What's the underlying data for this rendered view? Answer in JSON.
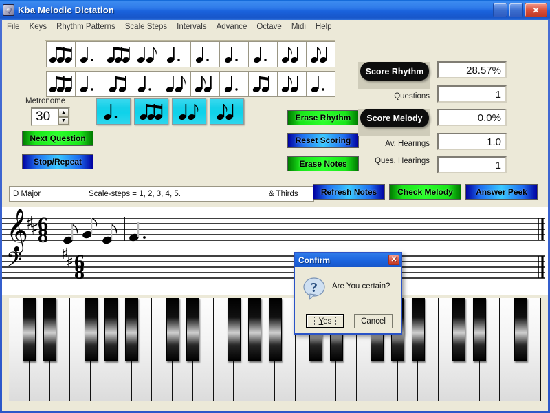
{
  "window": {
    "title": "Kba Melodic Dictation",
    "icon": "satellite-dish-icon",
    "buttons": {
      "minimize": "_",
      "maximize": "□",
      "close": "✕"
    }
  },
  "menu": {
    "items": [
      "File",
      "Keys",
      "Rhythm Patterns",
      "Scale Steps",
      "Intervals",
      "Advance",
      "Octave",
      "Midi",
      "Help"
    ]
  },
  "rhythm_grid": {
    "rows": [
      [
        "three-eighths",
        "dotted-quarter",
        "three-eighths",
        "quarter-eighth",
        "dotted-quarter",
        "dotted-quarter",
        "dotted-quarter",
        "dotted-quarter",
        "eighth-quarter",
        "eighth-quarter"
      ],
      [
        "three-eighths",
        "dotted-quarter",
        "two-eighths",
        "dotted-quarter",
        "quarter-eighth",
        "eighth-quarter",
        "dotted-quarter",
        "eighth-eighth",
        "eighth-quarter",
        "dotted-quarter"
      ]
    ]
  },
  "metronome": {
    "label": "Metronome",
    "value": "30",
    "up": "▲",
    "down": "▼"
  },
  "palette": {
    "items": [
      "dotted-quarter",
      "three-eighths",
      "quarter-eighth",
      "eighth-quarter"
    ]
  },
  "left_buttons": {
    "next_question": "Next Question",
    "stop_repeat": "Stop/Repeat"
  },
  "mid_buttons": {
    "erase_rhythm": "Erase Rhythm",
    "reset_scoring": "Reset Scoring",
    "erase_notes": "Erase Notes"
  },
  "scoring": {
    "score_rhythm_button": "Score Rhythm",
    "score_rhythm_value": "28.57%",
    "questions_label": "Questions",
    "questions_value": "1",
    "score_melody_button": "Score Melody",
    "score_melody_value": "0.0%",
    "av_hearings_label": "Av. Hearings",
    "av_hearings_value": "1.0",
    "ques_hearings_label": "Ques. Hearings",
    "ques_hearings_value": "1"
  },
  "info_row": {
    "key": "D Major",
    "scale_steps": "Scale-steps = 1, 2, 3, 4, 5.",
    "intervals": "& Thirds"
  },
  "action_buttons": {
    "refresh_notes": "Refresh Notes",
    "check_melody": "Check Melody",
    "answer_peek": "Answer Peek"
  },
  "staff": {
    "treble_clef": "treble-clef-icon",
    "bass_clef": "bass-clef-icon",
    "key_signature": "two-sharps",
    "time_signature": "6/8"
  },
  "dialog": {
    "title": "Confirm",
    "close": "✕",
    "icon": "question-bubble-icon",
    "message": "Are You certain?",
    "yes_label": "Yes",
    "yes_accel": "Y",
    "cancel_label": "Cancel"
  },
  "colors": {
    "green_button": "#2bff2b",
    "blue_button": "#39c8ff",
    "cyan_palette": "#16d0e8",
    "window_bg": "#ece9d8",
    "title_blue": "#1a63dd"
  }
}
